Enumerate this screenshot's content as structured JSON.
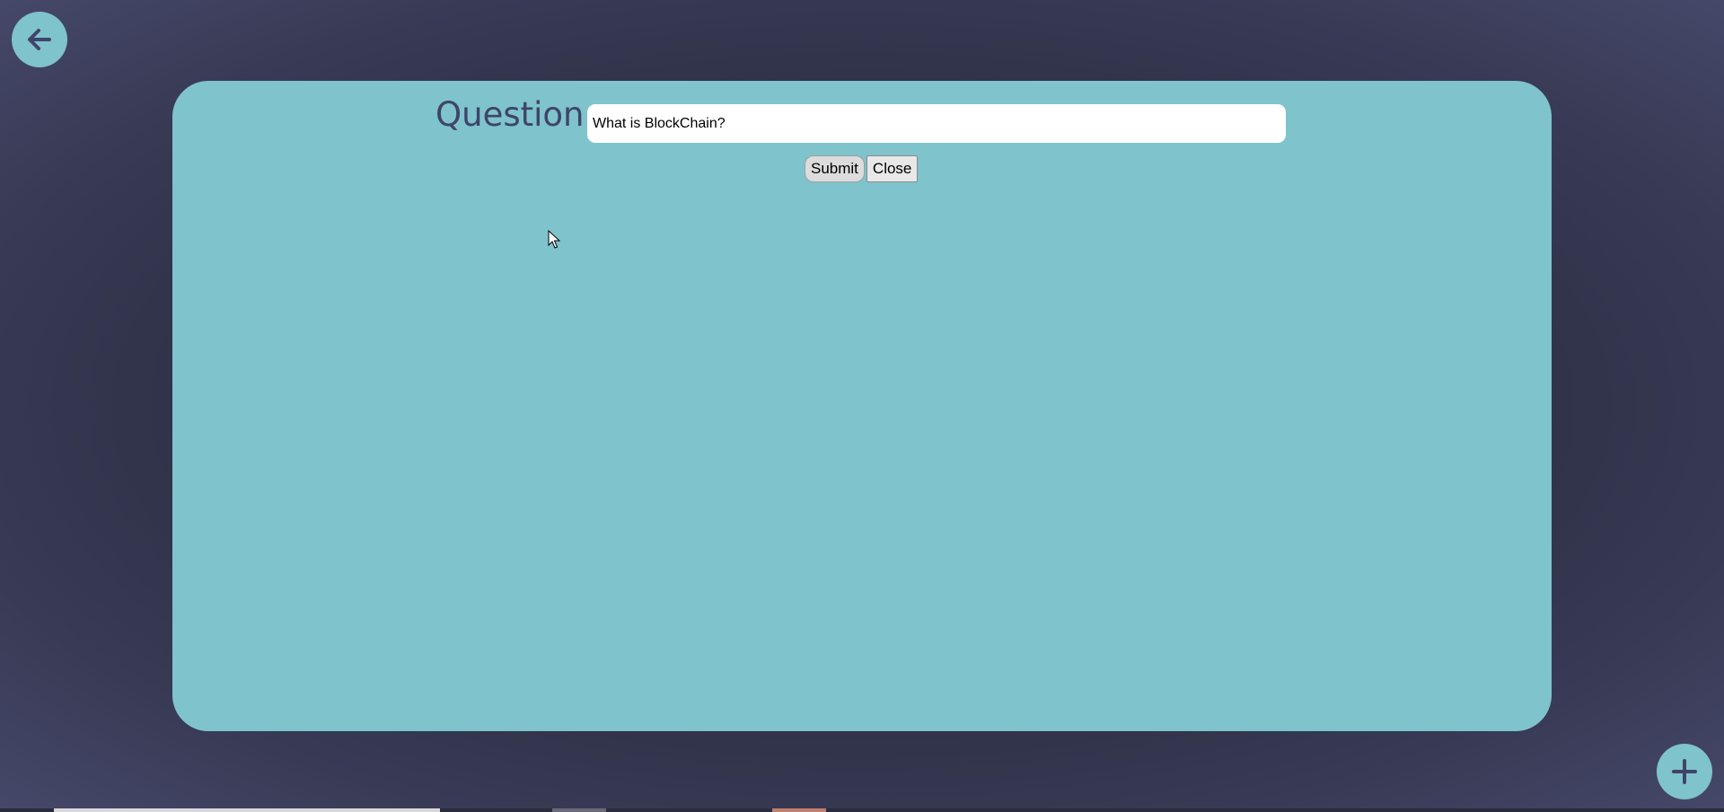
{
  "nav": {
    "back_icon": "arrow-left-icon",
    "add_icon": "plus-icon"
  },
  "form": {
    "label": "Question:",
    "input_value": "What is BlockChain?",
    "submit_label": "Submit",
    "close_label": "Close"
  },
  "colors": {
    "panel": "#7fc3cc",
    "label": "#3f4468",
    "background": "#2c2e42"
  }
}
